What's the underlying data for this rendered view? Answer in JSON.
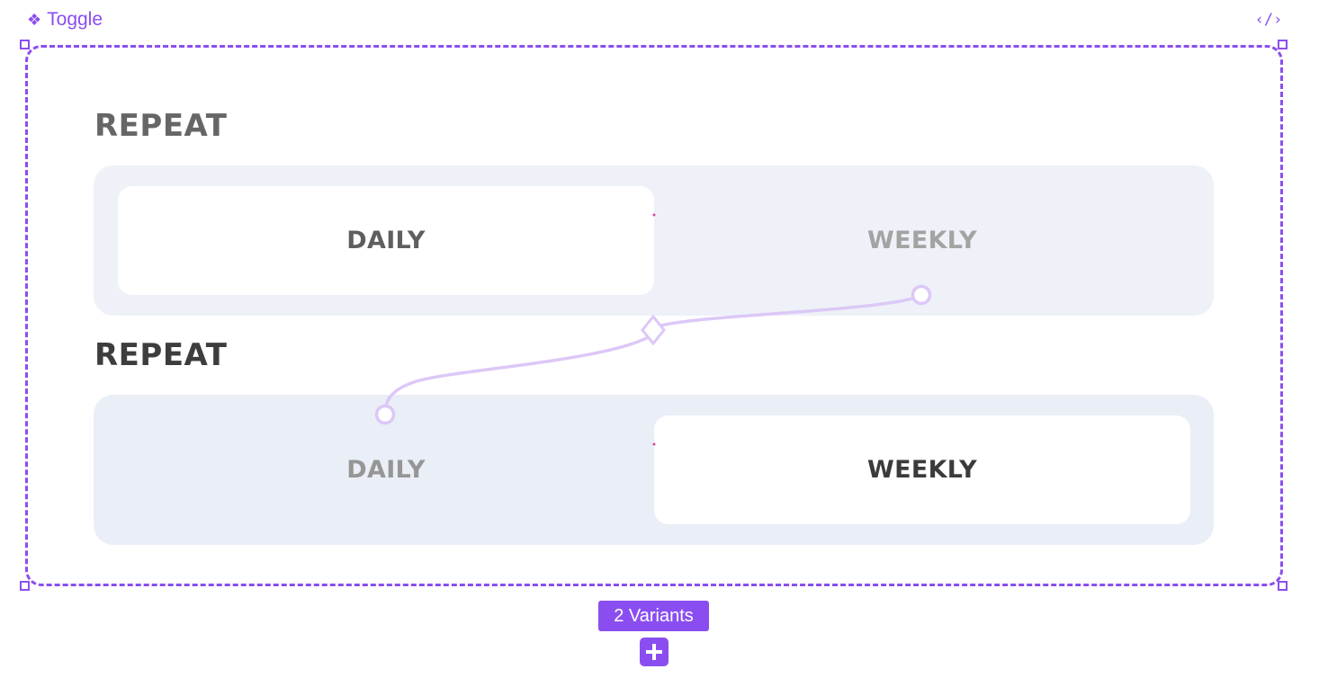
{
  "component": {
    "name": "Toggle",
    "icon": "component-diamond-icon",
    "code_icon": "code-icon"
  },
  "variants": [
    {
      "heading": "REPEAT",
      "options": [
        "DAILY",
        "WEEKLY"
      ],
      "selected": "DAILY"
    },
    {
      "heading": "REPEAT",
      "options": [
        "DAILY",
        "WEEKLY"
      ],
      "selected": "WEEKLY"
    }
  ],
  "variants_badge": "2 Variants",
  "add_variant_icon": "plus-icon",
  "colors": {
    "accent": "#8a4ef0",
    "connector": "#dcc8f7",
    "track": "#eef1f8",
    "selected_bg": "#ffffff",
    "heading_first": "#666666",
    "heading_second": "#3d3d3d",
    "selected_text_first": "#5f5f5f",
    "selected_text_second": "#3b3b3b",
    "unselected_text_first": "#a3a3a3",
    "unselected_text_second": "#969696"
  }
}
